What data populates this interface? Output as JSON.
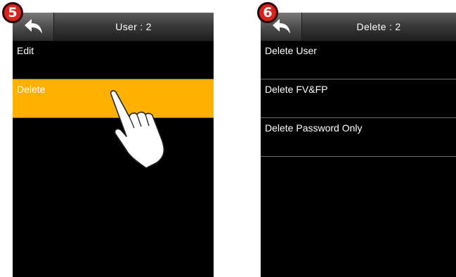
{
  "left_screen": {
    "step": "5",
    "title": "User : 2",
    "items": [
      {
        "label": "Edit"
      },
      {
        "label": "Delete"
      }
    ]
  },
  "right_screen": {
    "step": "6",
    "title": "Delete : 2",
    "items": [
      {
        "label": "Delete User"
      },
      {
        "label": "Delete FV&FP"
      },
      {
        "label": "Delete Password Only"
      }
    ]
  },
  "colors": {
    "selected_background": "#ffb000",
    "badge": "#d8241d",
    "screen_background": "#000000"
  },
  "icons": {
    "back": "back-arrow-icon",
    "pointer": "pointing-hand-icon"
  }
}
